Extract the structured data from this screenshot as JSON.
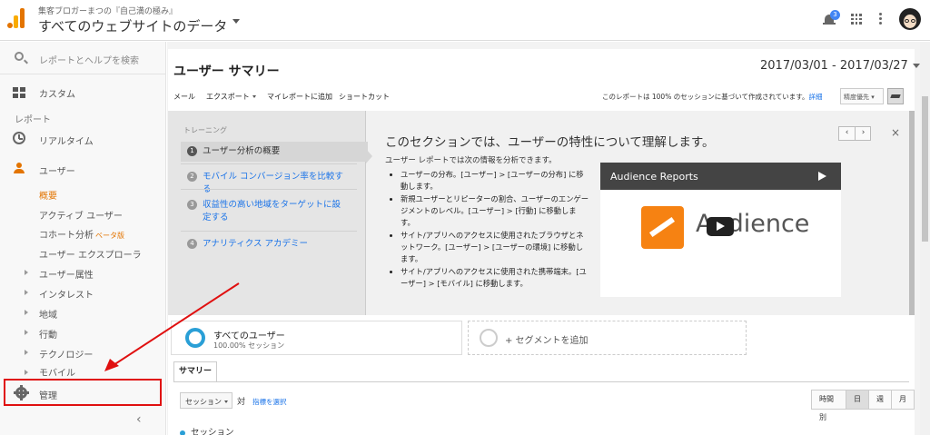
{
  "header": {
    "account_path": "集客ブロガーまつの『自己満の極み』",
    "view_name": "すべてのウェブサイトのデータ",
    "notification_count": "3"
  },
  "sidebar": {
    "search_placeholder": "レポートとヘルプを検索",
    "custom": "カスタム",
    "section_reports": "レポート",
    "realtime": "リアルタイム",
    "audience": "ユーザー",
    "audience_items": {
      "overview": "概要",
      "active_users": "アクティブ ユーザー",
      "cohort": "コホート分析",
      "cohort_badge": "ベータ版",
      "explorer": "ユーザー エクスプローラ"
    },
    "tree_items": [
      "ユーザー属性",
      "インタレスト",
      "地域",
      "行動",
      "テクノロジー",
      "モバイル"
    ],
    "admin": "管理",
    "collapse": "‹"
  },
  "main": {
    "title": "ユーザー サマリー",
    "date_range": "2017/03/01 - 2017/03/27",
    "toolbar": {
      "email": "メール",
      "export": "エクスポート",
      "add_to_dashboard": "マイレポートに追加",
      "shortcut": "ショートカット",
      "note": "このレポートは 100% のセッションに基づいて作成されています。",
      "detail_link": "詳細",
      "precision": "精度優先"
    },
    "training": {
      "header": "トレーニング",
      "steps": [
        {
          "num": "1",
          "label": "ユーザー分析の概要"
        },
        {
          "num": "2",
          "label": "モバイル コンバージョン率を比較する"
        },
        {
          "num": "3",
          "label": "収益性の高い地域をターゲットに設定する"
        },
        {
          "num": "4",
          "label": "アナリティクス アカデミー"
        }
      ],
      "title": "このセクションでは、ユーザーの特性について理解します。",
      "intro": "ユーザー レポートでは次の情報を分析できます。",
      "bullets": [
        "ユーザーの分布。[ユーザー] > [ユーザーの分布] に移動します。",
        "新規ユーザーとリピーターの割合、ユーザーのエンゲージメントのレベル。[ユーザー] > [行動] に移動します。",
        "サイト/アプリへのアクセスに使用されたブラウザとネットワーク。[ユーザー] > [ユーザーの環境] に移動します。",
        "サイト/アプリへのアクセスに使用された携帯端末。[ユーザー] > [モバイル] に移動します。"
      ],
      "nav_prev": "‹",
      "nav_next": "›",
      "close": "×",
      "video_title": "Audience Reports",
      "video_brand": "Audience"
    },
    "segments": {
      "all_users": "すべてのユーザー",
      "all_users_sub": "100.00% セッション",
      "add_segment": "+ セグメントを追加"
    },
    "summary_tab": "サマリー",
    "metric_select": "セッション",
    "vs": "対",
    "pick_metric": "指標を選択",
    "periods": [
      "時間別",
      "日",
      "週",
      "月"
    ],
    "selected_period": "日",
    "legend": "セッション"
  },
  "colors": {
    "accent_orange": "#e37400",
    "link_blue": "#1a73e8",
    "segment_blue": "#2a9fd6",
    "annotation_red": "#e01010"
  }
}
